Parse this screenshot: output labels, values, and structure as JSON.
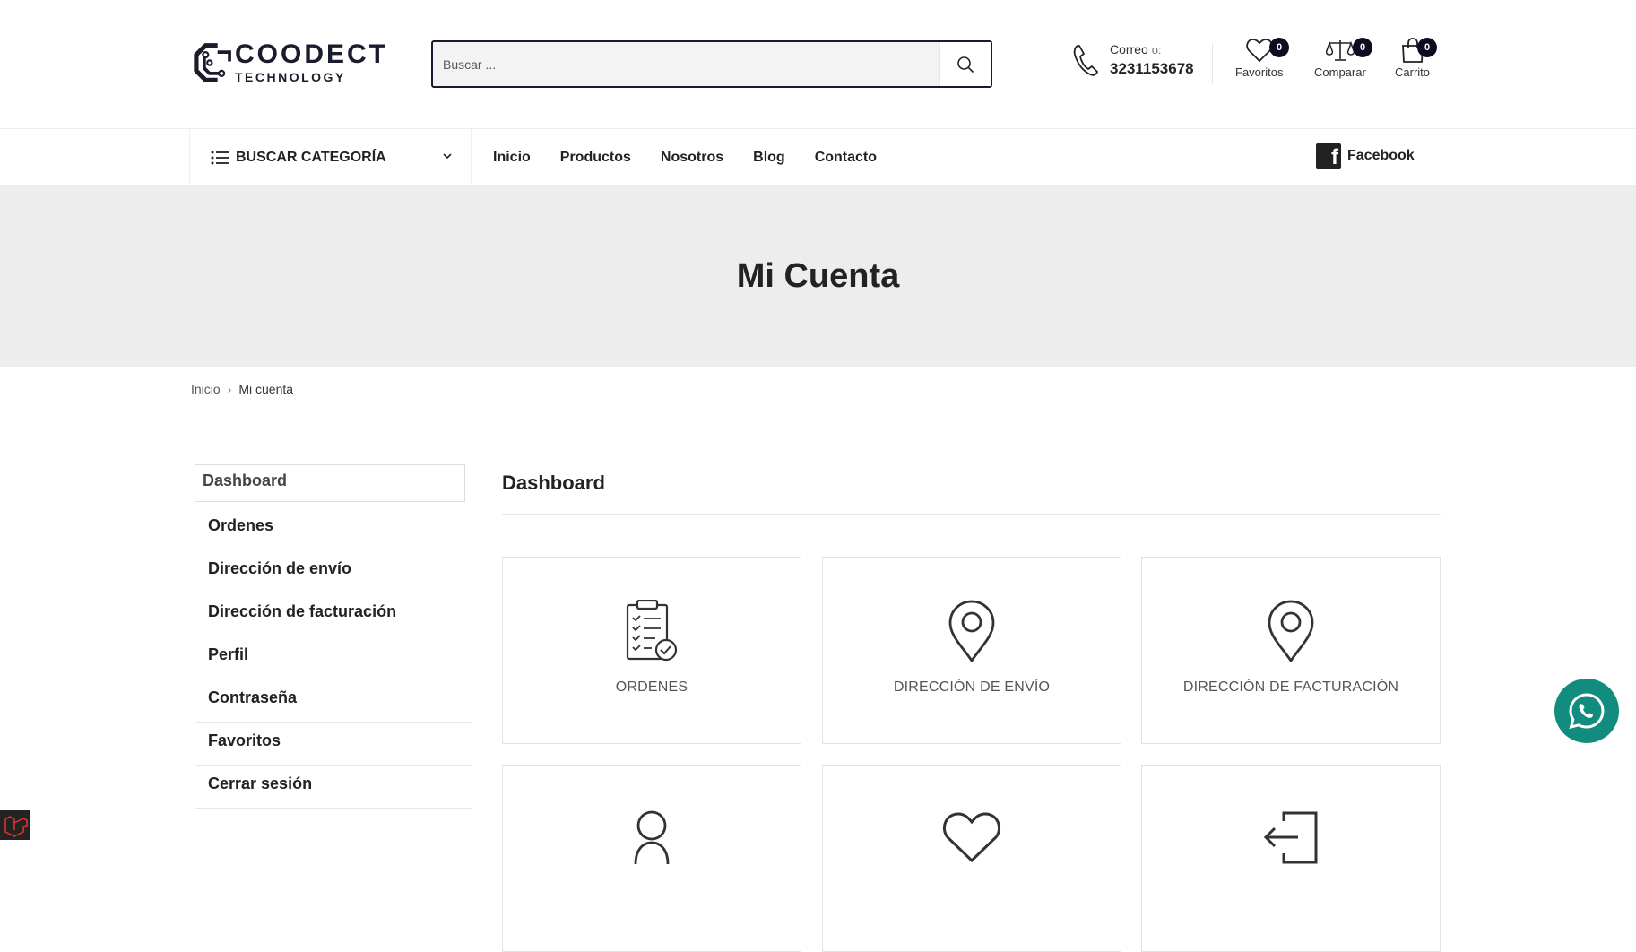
{
  "brand": {
    "name_line1": "COODECT",
    "name_line2": "TECHNOLOGY"
  },
  "search": {
    "placeholder": "Buscar ..."
  },
  "contact": {
    "label": "Correo",
    "label_suffix": "o:",
    "phone": "3231153678"
  },
  "header_icons": [
    {
      "label": "Favoritos",
      "count": "0",
      "icon": "heart-icon"
    },
    {
      "label": "Comparar",
      "count": "0",
      "icon": "scale-icon"
    },
    {
      "label": "Carrito",
      "count": "0",
      "icon": "bag-icon"
    }
  ],
  "nav": {
    "category_label": "BUSCAR CATEGORÍA",
    "items": [
      "Inicio",
      "Productos",
      "Nosotros",
      "Blog",
      "Contacto"
    ],
    "social": "Facebook"
  },
  "page": {
    "title": "Mi Cuenta"
  },
  "breadcrumb": {
    "home": "Inicio",
    "current": "Mi cuenta"
  },
  "sidebar": {
    "items": [
      "Dashboard",
      "Ordenes",
      "Dirección de envío",
      "Dirección de facturación",
      "Perfil",
      "Contraseña",
      "Favoritos",
      "Cerrar sesión"
    ],
    "active": "Dashboard"
  },
  "main": {
    "title": "Dashboard",
    "cards": [
      {
        "label": "ORDENES",
        "icon": "clipboard-check-icon"
      },
      {
        "label": "DIRECCIÓN DE ENVÍO",
        "icon": "map-pin-icon"
      },
      {
        "label": "DIRECCIÓN DE FACTURACIÓN",
        "icon": "map-pin-icon"
      },
      {
        "label": "",
        "icon": "user-icon"
      },
      {
        "label": "",
        "icon": "heart-icon"
      },
      {
        "label": "",
        "icon": "logout-icon"
      }
    ]
  },
  "colors": {
    "brand_dark": "#1b1b2e",
    "badge": "#0d0d22",
    "banner_bg": "#ededed",
    "whatsapp": "#128c7e"
  }
}
